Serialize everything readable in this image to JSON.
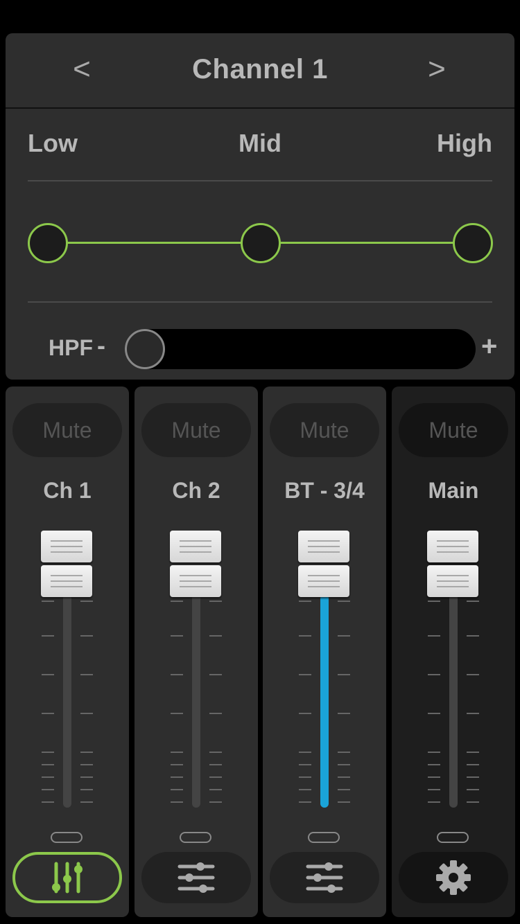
{
  "header": {
    "prev_label": "<",
    "title": "Channel 1",
    "next_label": ">"
  },
  "eq": {
    "bands": [
      "Low",
      "Mid",
      "High"
    ],
    "hpf_label": "HPF",
    "hpf_minus": "-",
    "hpf_plus": "+",
    "accent_color": "#8cc84b"
  },
  "strips": [
    {
      "mute_label": "Mute",
      "name": "Ch 1",
      "fader_level": 1.0,
      "bottom_icon": "eq-faders-icon",
      "bottom_active": true
    },
    {
      "mute_label": "Mute",
      "name": "Ch 2",
      "fader_level": 1.0,
      "bottom_icon": "sliders-icon",
      "bottom_active": false
    },
    {
      "mute_label": "Mute",
      "name": "BT - 3/4",
      "fader_level": 1.0,
      "bottom_icon": "sliders-icon",
      "bottom_active": false,
      "meter_color": "#1aa3d8"
    },
    {
      "mute_label": "Mute",
      "name": "Main",
      "fader_level": 1.0,
      "bottom_icon": "gear-icon",
      "bottom_active": false
    }
  ]
}
